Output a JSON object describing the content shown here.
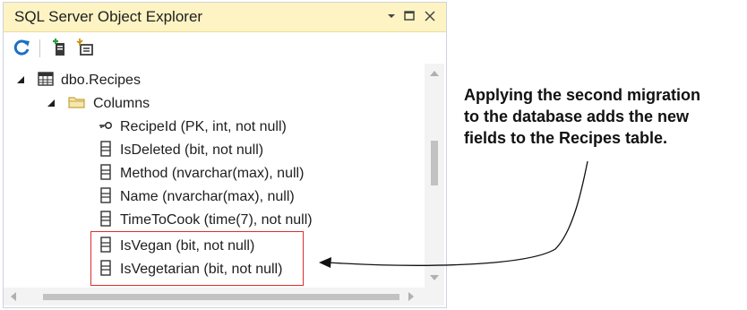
{
  "window": {
    "title": "SQL Server Object Explorer",
    "controls": {
      "dropdown_icon": "chevron-down-icon",
      "maximize_icon": "maximize-icon",
      "close_icon": "close-icon"
    }
  },
  "toolbar": {
    "refresh_icon": "refresh-icon",
    "add_sql_server_icon": "add-server-icon",
    "new_query_icon": "new-query-icon"
  },
  "tree": {
    "table": {
      "label": "dbo.Recipes",
      "expanded": true
    },
    "columns_folder": {
      "label": "Columns",
      "expanded": true
    },
    "columns": [
      {
        "label": "RecipeId (PK, int, not null)",
        "icon": "key-icon"
      },
      {
        "label": "IsDeleted (bit, not null)",
        "icon": "column-icon"
      },
      {
        "label": "Method (nvarchar(max), null)",
        "icon": "column-icon"
      },
      {
        "label": "Name (nvarchar(max), null)",
        "icon": "column-icon"
      },
      {
        "label": "TimeToCook (time(7), not null)",
        "icon": "column-icon"
      },
      {
        "label": "IsVegan (bit, not null)",
        "icon": "column-icon"
      },
      {
        "label": "IsVegetarian (bit, not null)",
        "icon": "column-icon"
      }
    ]
  },
  "annotation": {
    "line1": "Applying the second migration",
    "line2": "to the database adds the new",
    "line3": "fields to the Recipes table."
  },
  "colors": {
    "titlebar": "#fdf3c3",
    "highlight": "#d9302c",
    "refresh": "#1c6fc4"
  }
}
